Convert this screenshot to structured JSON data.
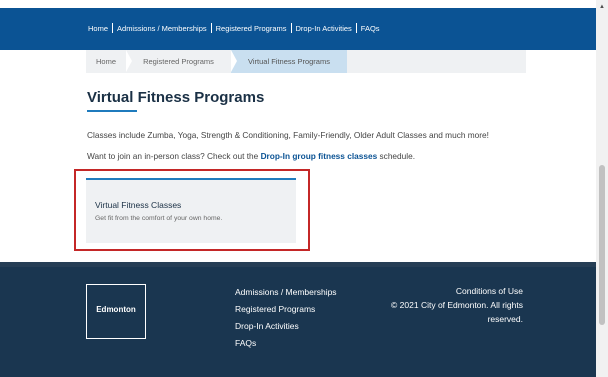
{
  "nav": {
    "items": [
      "Home",
      "Admissions / Memberships",
      "Registered Programs",
      "Drop-In Activities",
      "FAQs"
    ]
  },
  "breadcrumb": {
    "home": "Home",
    "registered": "Registered Programs",
    "current": "Virtual Fitness Programs"
  },
  "main": {
    "title": "Virtual Fitness Programs",
    "intro": "Classes include Zumba, Yoga, Strength & Conditioning, Family-Friendly, Older Adult Classes and much more!",
    "join_prefix": "Want to join an in-person class? Check out the ",
    "join_link": "Drop-In group fitness classes",
    "join_suffix": " schedule."
  },
  "card": {
    "title": "Virtual Fitness Classes",
    "subtitle": "Get fit from the comfort of your own home."
  },
  "footer": {
    "logo": "Edmonton",
    "links": [
      "Admissions / Memberships",
      "Registered Programs",
      "Drop-In Activities",
      "FAQs"
    ],
    "conditions": "Conditions of Use",
    "copyright": "© 2021 City of Edmonton. All rights reserved."
  },
  "scrollbar": {
    "up_arrow": "▲"
  },
  "colors": {
    "nav": "#0b5394",
    "footer": "#1a3650",
    "accent": "#1f7bbd",
    "highlight": "#c42727"
  }
}
